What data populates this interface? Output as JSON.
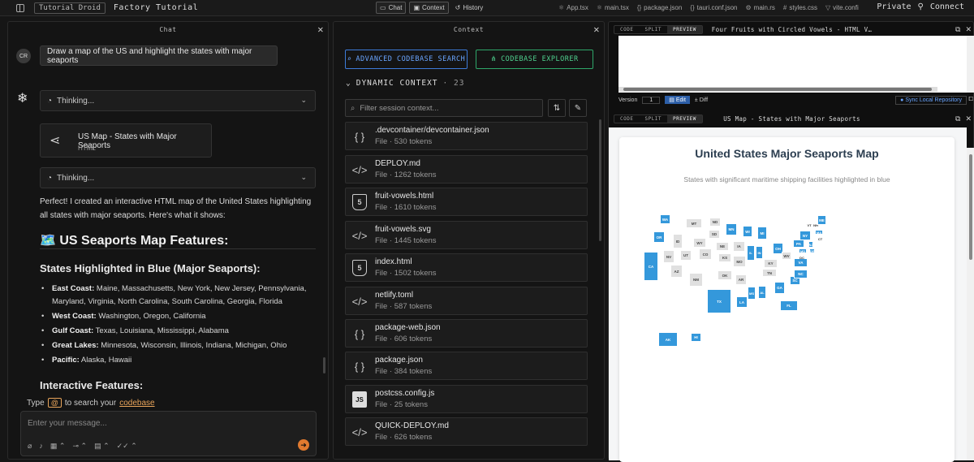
{
  "topbar": {
    "badge": "Tutorial Droid",
    "project": "Factory Tutorial",
    "tabs": [
      {
        "label": "Chat",
        "icon": "chat-icon",
        "active": true
      },
      {
        "label": "Context",
        "icon": "context-icon",
        "active": true
      },
      {
        "label": "History",
        "icon": "history-icon",
        "active": false
      }
    ],
    "files": [
      "App.tsx",
      "main.tsx",
      "package.json",
      "tauri.conf.json",
      "main.rs",
      "styles.css",
      "vite.confi"
    ],
    "private_label": "Private",
    "connect_label": "Connect"
  },
  "chat": {
    "title": "Chat",
    "avatar": "CR",
    "user_message": "Draw a map of the US and highlight the states with major seaports",
    "thinking_1": "Thinking...",
    "artifact_title": "US Map - States with Major Seaports",
    "artifact_type": "HTML",
    "thinking_2": "Thinking...",
    "response": "Perfect! I created an interactive HTML map of the United States highlighting all states with major seaports. Here's what it shows:",
    "heading": "🗺️ US Seaports Map Features:",
    "subheading": "States Highlighted in Blue (Major Seaports):",
    "bullets": [
      {
        "label": "East Coast:",
        "text": "Maine, Massachusetts, New York, New Jersey, Pennsylvania, Maryland, Virginia, North Carolina, South Carolina, Georgia, Florida"
      },
      {
        "label": "West Coast:",
        "text": "Washington, Oregon, California"
      },
      {
        "label": "Gulf Coast:",
        "text": "Texas, Louisiana, Mississippi, Alabama"
      },
      {
        "label": "Great Lakes:",
        "text": "Minnesota, Wisconsin, Illinois, Indiana, Michigan, Ohio"
      },
      {
        "label": "Pacific:",
        "text": "Alaska, Hawaii"
      }
    ],
    "interactive_heading": "Interactive Features:",
    "hint_type": "Type",
    "hint_at": "@",
    "hint_mid": "to search your",
    "hint_link": "codebase",
    "input_placeholder": "Enter your message..."
  },
  "context": {
    "title": "Context",
    "btn_search": "ADVANCED CODEBASE SEARCH",
    "btn_explorer": "CODEBASE EXPLORER",
    "dynamic_label": "DYNAMIC CONTEXT",
    "dynamic_count": "· 23",
    "filter_placeholder": "Filter session context...",
    "files": [
      {
        "name": ".devcontainer/devcontainer.json",
        "meta": "File · 530 tokens",
        "icon": "json"
      },
      {
        "name": "DEPLOY.md",
        "meta": "File · 1262 tokens",
        "icon": "code"
      },
      {
        "name": "fruit-vowels.html",
        "meta": "File · 1610 tokens",
        "icon": "html"
      },
      {
        "name": "fruit-vowels.svg",
        "meta": "File · 1445 tokens",
        "icon": "code"
      },
      {
        "name": "index.html",
        "meta": "File · 1502 tokens",
        "icon": "html"
      },
      {
        "name": "netlify.toml",
        "meta": "File · 587 tokens",
        "icon": "code"
      },
      {
        "name": "package-web.json",
        "meta": "File · 606 tokens",
        "icon": "json"
      },
      {
        "name": "package.json",
        "meta": "File · 384 tokens",
        "icon": "json"
      },
      {
        "name": "postcss.config.js",
        "meta": "File · 25 tokens",
        "icon": "js"
      },
      {
        "name": "QUICK-DEPLOY.md",
        "meta": "File · 626 tokens",
        "icon": "code"
      }
    ]
  },
  "preview": {
    "modes": [
      "CODE",
      "SPLIT",
      "PREVIEW"
    ],
    "top_title": "Four Fruits with Circled Vowels - HTML V…",
    "version_label": "Version",
    "version_value": "1",
    "edit_label": "Edit",
    "diff_label": "Diff",
    "sync_label": "Sync Local Repository",
    "bottom_title": "US Map - States with Major Seaports",
    "map_title": "United States Major Seaports Map",
    "map_subtitle": "States with significant maritime shipping facilities highlighted in blue",
    "colors": {
      "port": "#3498db",
      "other": "#e0e0e0"
    }
  },
  "map_states": [
    {
      "code": "WA",
      "port": true
    },
    {
      "code": "OR",
      "port": true
    },
    {
      "code": "CA",
      "port": true
    },
    {
      "code": "ID",
      "port": false
    },
    {
      "code": "NV",
      "port": false
    },
    {
      "code": "MT",
      "port": false
    },
    {
      "code": "WY",
      "port": false
    },
    {
      "code": "UT",
      "port": false
    },
    {
      "code": "CO",
      "port": false
    },
    {
      "code": "AZ",
      "port": false
    },
    {
      "code": "NM",
      "port": false
    },
    {
      "code": "ND",
      "port": false
    },
    {
      "code": "SD",
      "port": false
    },
    {
      "code": "NE",
      "port": false
    },
    {
      "code": "KS",
      "port": false
    },
    {
      "code": "OK",
      "port": false
    },
    {
      "code": "TX",
      "port": true
    },
    {
      "code": "MN",
      "port": true
    },
    {
      "code": "IA",
      "port": false
    },
    {
      "code": "MO",
      "port": false
    },
    {
      "code": "AR",
      "port": false
    },
    {
      "code": "LA",
      "port": true
    },
    {
      "code": "WI",
      "port": true
    },
    {
      "code": "IL",
      "port": true
    },
    {
      "code": "MI",
      "port": true
    },
    {
      "code": "IN",
      "port": true
    },
    {
      "code": "OH",
      "port": true
    },
    {
      "code": "KY",
      "port": false
    },
    {
      "code": "TN",
      "port": false
    },
    {
      "code": "MS",
      "port": true
    },
    {
      "code": "AL",
      "port": true
    },
    {
      "code": "GA",
      "port": true
    },
    {
      "code": "FL",
      "port": true
    },
    {
      "code": "SC",
      "port": true
    },
    {
      "code": "NC",
      "port": true
    },
    {
      "code": "VA",
      "port": true
    },
    {
      "code": "WV",
      "port": false
    },
    {
      "code": "PA",
      "port": true
    },
    {
      "code": "NY",
      "port": true
    },
    {
      "code": "NJ",
      "port": true
    },
    {
      "code": "MD",
      "port": true
    },
    {
      "code": "DE",
      "port": true
    },
    {
      "code": "DC",
      "port": false
    },
    {
      "code": "VT",
      "port": false
    },
    {
      "code": "NH",
      "port": false
    },
    {
      "code": "ME",
      "port": true
    },
    {
      "code": "MA",
      "port": true
    },
    {
      "code": "CT",
      "port": false
    },
    {
      "code": "AK",
      "port": true
    },
    {
      "code": "HI",
      "port": true
    }
  ]
}
